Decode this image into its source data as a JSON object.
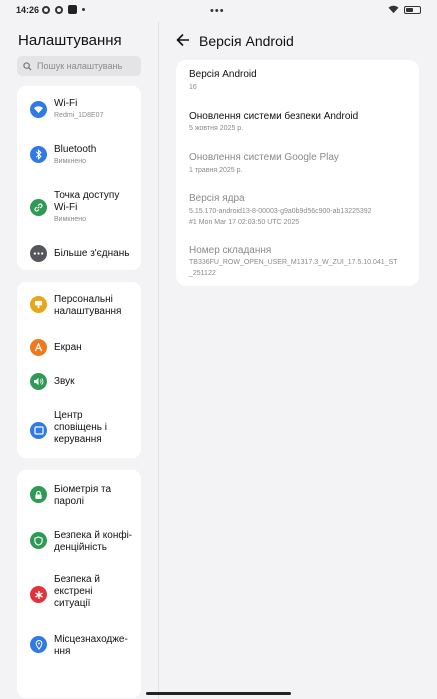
{
  "status": {
    "time": "14:26",
    "center": "•••"
  },
  "sidebar": {
    "title": "Налаштування",
    "search_placeholder": "Пошук налаштувань",
    "wifi": {
      "label": "Wi-Fi",
      "sub": "Redmi_1D8E07"
    },
    "bluetooth": {
      "label": "Bluetooth",
      "sub": "Вимкнено"
    },
    "hotspot": {
      "label1": "Точка доступу",
      "label2": "Wi-Fi",
      "sub": "Вимкнено"
    },
    "more": {
      "label": "Більше з'єднань"
    },
    "personal": {
      "label1": "Персональні",
      "label2": "налаштування"
    },
    "screen": {
      "label": "Екран"
    },
    "sound": {
      "label": "Звук"
    },
    "notify": {
      "label1": "Центр",
      "label2": "сповіщень і",
      "label3": "керування"
    },
    "biometry": {
      "label1": "Біометрія та",
      "label2": "паролі"
    },
    "privacy": {
      "label1": "Безпека й конфі-",
      "label2": "денційність"
    },
    "emergency": {
      "label1": "Безпека й",
      "label2": "екстрені",
      "label3": "ситуації"
    },
    "location": {
      "label1": "Місцезнаходже-",
      "label2": "ння"
    }
  },
  "main": {
    "title": "Версія Android",
    "rows": [
      {
        "title": "Версія Android",
        "value": "16"
      },
      {
        "title": "Оновлення системи безпеки Android",
        "value": "5 жовтня 2025 р."
      },
      {
        "title": "Оновлення системи Google Play",
        "value": "1 травня 2025 р."
      },
      {
        "title": "Версія ядра",
        "value1": "5.15.170-android13-8-00003-g9a0b9d56c900-ab13225392",
        "value2": "#1 Mon Mar 17 02:03:50 UTC 2025"
      },
      {
        "title": "Номер складання",
        "value1": "TB336FU_ROW_OPEN_USER_M1317.3_W_ZUI_17.5.10.041_ST",
        "value2": "_251122"
      }
    ]
  },
  "colors": {
    "wifi": "#2f7ae5",
    "bluetooth": "#2f7ae5",
    "hotspot": "#2f9a55",
    "more": "#55575d",
    "personal": "#e6a818",
    "screen": "#ee7a1f",
    "sound": "#2f9a55",
    "notify": "#2f7ae5",
    "biometry": "#2f9a55",
    "privacy": "#2f9a55",
    "emergency": "#e0343b",
    "location": "#2f7ae5"
  }
}
